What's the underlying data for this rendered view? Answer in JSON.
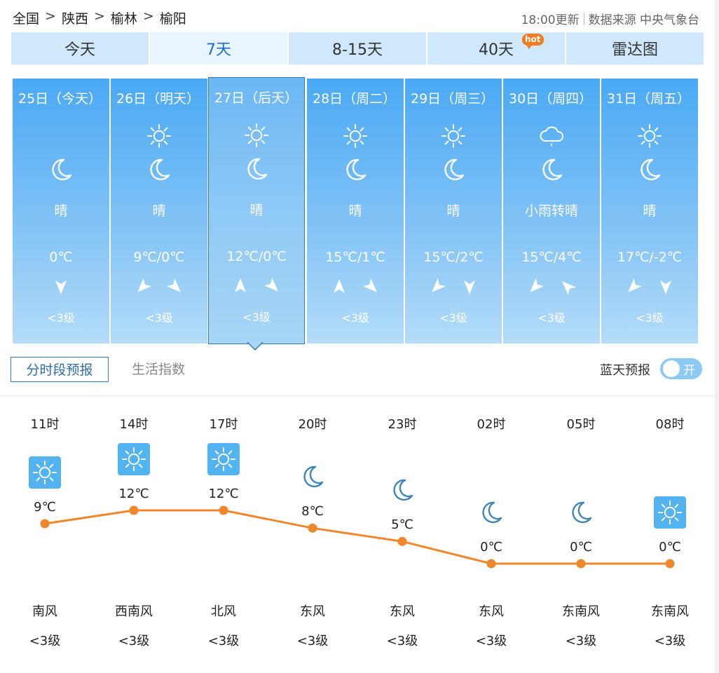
{
  "breadcrumb": {
    "items": [
      "全国",
      "陕西",
      "榆林",
      "榆阳"
    ],
    "separator": ">"
  },
  "source": {
    "update": "18:00更新",
    "label": "数据来源 中央气象台"
  },
  "tabs": [
    {
      "label": "今天",
      "active": false
    },
    {
      "label": "7天",
      "active": true
    },
    {
      "label": "8-15天",
      "active": false
    },
    {
      "label": "40天",
      "active": false,
      "badge": "hot"
    },
    {
      "label": "雷达图",
      "active": false
    }
  ],
  "days": [
    {
      "date": "25日（今天）",
      "icons": [
        "moon-icon"
      ],
      "weather": "晴",
      "temp": "0℃",
      "winds": [
        "north"
      ],
      "level": "<3级"
    },
    {
      "date": "26日（明天）",
      "icons": [
        "sun-icon",
        "moon-icon"
      ],
      "weather": "晴",
      "temp": "9℃/0℃",
      "winds": [
        "northeast",
        "northwest"
      ],
      "level": "<3级"
    },
    {
      "date": "27日（后天）",
      "icons": [
        "sun-icon",
        "moon-icon"
      ],
      "weather": "晴",
      "temp": "12℃/0℃",
      "winds": [
        "south",
        "northwest"
      ],
      "level": "<3级",
      "selected": true
    },
    {
      "date": "28日（周二）",
      "icons": [
        "sun-icon",
        "moon-icon"
      ],
      "weather": "晴",
      "temp": "15℃/1℃",
      "winds": [
        "south",
        "northwest"
      ],
      "level": "<3级"
    },
    {
      "date": "29日（周三）",
      "icons": [
        "sun-icon",
        "moon-icon"
      ],
      "weather": "晴",
      "temp": "15℃/2℃",
      "winds": [
        "northeast",
        "north"
      ],
      "level": "<3级"
    },
    {
      "date": "30日（周四）",
      "icons": [
        "rain-cloud-icon",
        "moon-icon"
      ],
      "weather": "小雨转晴",
      "temp": "15℃/4℃",
      "winds": [
        "northeast",
        "southwest"
      ],
      "level": "<3级"
    },
    {
      "date": "31日（周五）",
      "icons": [
        "sun-icon",
        "moon-icon"
      ],
      "weather": "晴",
      "temp": "17℃/-2℃",
      "winds": [
        "northeast",
        "north"
      ],
      "level": "<3级"
    }
  ],
  "subtabs": {
    "hourly": "分时段预报",
    "life": "生活指数"
  },
  "toggle": {
    "label": "蓝天预报",
    "state": "开"
  },
  "hourly": [
    {
      "hour": "11时",
      "icon": "sun-icon",
      "temp": 9,
      "temp_label": "9℃",
      "wind": "南风",
      "level": "<3级"
    },
    {
      "hour": "14时",
      "icon": "sun-icon",
      "temp": 12,
      "temp_label": "12℃",
      "wind": "西南风",
      "level": "<3级"
    },
    {
      "hour": "17时",
      "icon": "sun-icon",
      "temp": 12,
      "temp_label": "12℃",
      "wind": "北风",
      "level": "<3级"
    },
    {
      "hour": "20时",
      "icon": "moon-icon",
      "temp": 8,
      "temp_label": "8℃",
      "wind": "东风",
      "level": "<3级"
    },
    {
      "hour": "23时",
      "icon": "moon-icon",
      "temp": 5,
      "temp_label": "5℃",
      "wind": "东风",
      "level": "<3级"
    },
    {
      "hour": "02时",
      "icon": "moon-icon",
      "temp": 0,
      "temp_label": "0℃",
      "wind": "东风",
      "level": "<3级"
    },
    {
      "hour": "05时",
      "icon": "moon-icon",
      "temp": 0,
      "temp_label": "0℃",
      "wind": "东南风",
      "level": "<3级"
    },
    {
      "hour": "08时",
      "icon": "sun-icon",
      "temp": 0,
      "temp_label": "0℃",
      "wind": "东南风",
      "level": "<3级"
    }
  ],
  "chart_data": {
    "type": "line",
    "categories": [
      "11时",
      "14时",
      "17时",
      "20时",
      "23时",
      "02时",
      "05时",
      "08时"
    ],
    "values": [
      9,
      12,
      12,
      8,
      5,
      0,
      0,
      0
    ],
    "line_color": "#f0872b"
  },
  "colors": {
    "accent": "#1e6bd6",
    "card_top": "#4aa9f4",
    "line": "#f0872b",
    "sun_box": "#53b3f1"
  }
}
